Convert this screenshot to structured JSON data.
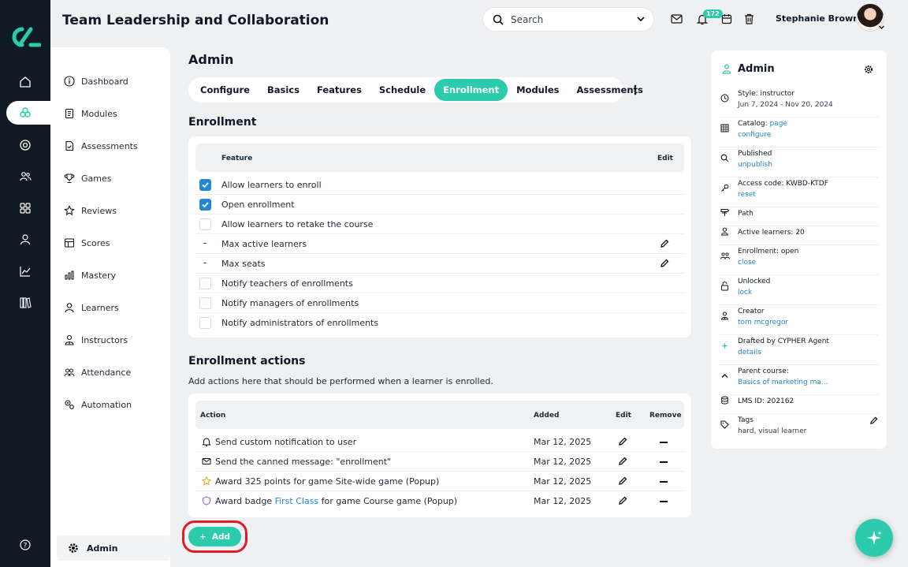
{
  "app": {
    "title": "Team Leadership and Collaboration"
  },
  "search": {
    "label": "Search"
  },
  "notifications": {
    "count": "172"
  },
  "user": {
    "name": "Stephanie Brown"
  },
  "colors": {
    "accent": "#2ccbae",
    "rail": "#0f1a24",
    "link": "#2487d6",
    "highlight": "#e21b23"
  },
  "rail_icons": [
    "logo-icon",
    "home-icon",
    "modules-icon",
    "target-icon",
    "people-icon",
    "grid-icon",
    "person-icon",
    "chart-icon",
    "library-icon",
    "help-icon"
  ],
  "sidebar": {
    "items": [
      {
        "label": "Dashboard",
        "icon": "info-icon"
      },
      {
        "label": "Modules",
        "icon": "book-icon"
      },
      {
        "label": "Assessments",
        "icon": "document-icon"
      },
      {
        "label": "Games",
        "icon": "trophy-icon"
      },
      {
        "label": "Reviews",
        "icon": "star-icon"
      },
      {
        "label": "Scores",
        "icon": "table-icon"
      },
      {
        "label": "Mastery",
        "icon": "bars-icon"
      },
      {
        "label": "Learners",
        "icon": "user-icon"
      },
      {
        "label": "Instructors",
        "icon": "instructor-icon"
      },
      {
        "label": "Attendance",
        "icon": "group-icon"
      },
      {
        "label": "Automation",
        "icon": "gears-icon"
      }
    ],
    "admin_label": "Admin"
  },
  "main": {
    "heading": "Admin",
    "tabs": [
      {
        "label": "Configure"
      },
      {
        "label": "Basics"
      },
      {
        "label": "Features"
      },
      {
        "label": "Schedule"
      },
      {
        "label": "Enrollment",
        "active": true
      },
      {
        "label": "Modules"
      },
      {
        "label": "Assessments"
      }
    ],
    "enrollment": {
      "heading": "Enrollment",
      "col_feature": "Feature",
      "col_edit": "Edit",
      "rows": [
        {
          "label": "Allow learners to enroll",
          "type": "checkbox",
          "checked": true
        },
        {
          "label": "Open enrollment",
          "type": "checkbox",
          "checked": true
        },
        {
          "label": "Allow learners to retake the course",
          "type": "checkbox",
          "checked": false
        },
        {
          "label": "Max active learners",
          "type": "value",
          "value": "-",
          "editable": true
        },
        {
          "label": "Max seats",
          "type": "value",
          "value": "-",
          "editable": true
        },
        {
          "label": "Notify teachers of enrollments",
          "type": "checkbox",
          "checked": false
        },
        {
          "label": "Notify managers of enrollments",
          "type": "checkbox",
          "checked": false
        },
        {
          "label": "Notify administrators of enrollments",
          "type": "checkbox",
          "checked": false
        }
      ]
    },
    "actions": {
      "heading": "Enrollment actions",
      "description": "Add actions here that should be performed when a learner is enrolled.",
      "col_action": "Action",
      "col_added": "Added",
      "col_edit": "Edit",
      "col_remove": "Remove",
      "rows": [
        {
          "icon": "bell-icon",
          "text": "Send custom notification to user",
          "added": "Mar 12, 2025"
        },
        {
          "icon": "envelope-icon",
          "text": "Send the canned message: \"enrollment\"",
          "added": "Mar 12, 2025"
        },
        {
          "icon": "star-icon",
          "text": "Award 325 points for game Site-wide game (Popup)",
          "added": "Mar 12, 2025"
        },
        {
          "icon": "shield-icon",
          "text_before": "Award badge ",
          "text_link": "First Class",
          "text_after": " for game Course game (Popup)",
          "added": "Mar 12, 2025"
        }
      ],
      "add_label": "Add"
    }
  },
  "right_panel": {
    "title": "Admin",
    "rows": [
      {
        "icon": "clock-icon",
        "text": "Style: instructor",
        "sub": "Jun 7, 2024 - Nov 20, 2024",
        "sub_style": "text"
      },
      {
        "icon": "grid-icon",
        "text": "Catalog: ",
        "text_link": "page",
        "sub": "configure",
        "sub_style": "link"
      },
      {
        "icon": "search-icon",
        "text": "Published",
        "sub": "unpublish",
        "sub_style": "link"
      },
      {
        "icon": "key-icon",
        "text": "Access code: KWBD-KTDF",
        "sub": "reset",
        "sub_style": "link"
      },
      {
        "icon": "signpost-icon",
        "text": "Path"
      },
      {
        "icon": "user-icon",
        "text": "Active learners: 20"
      },
      {
        "icon": "group-icon",
        "text": "Enrollment: open",
        "sub": "close",
        "sub_style": "link"
      },
      {
        "icon": "unlock-icon",
        "text": "Unlocked",
        "sub": "lock",
        "sub_style": "link"
      },
      {
        "icon": "creator-icon",
        "text": "Creator",
        "sub": "tom mcgregor",
        "sub_style": "link"
      },
      {
        "icon": "sparkle-icon",
        "text": "Drafted by CYPHER Agent",
        "sub": "details",
        "sub_style": "link"
      },
      {
        "icon": "chevron-up-icon",
        "text": "Parent course:",
        "sub": "Basics of marketing ma...",
        "sub_style": "link"
      },
      {
        "icon": "database-icon",
        "text": "LMS ID: 202162"
      },
      {
        "icon": "tag-icon",
        "text": "Tags",
        "sub": "hard, visual learner",
        "sub_style": "text",
        "editable": true
      }
    ]
  }
}
